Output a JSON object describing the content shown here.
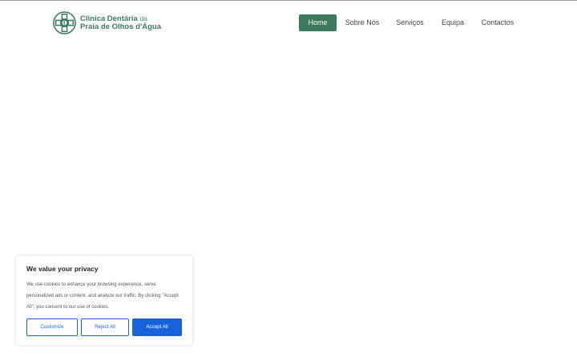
{
  "logo": {
    "line1": "Clinica Dentária",
    "line1_suffix": "da",
    "line2": "Praia de Olhos d'Água",
    "icon": "clinic-cross-logo-icon",
    "brand_color": "#3d7a5f"
  },
  "nav": {
    "items": [
      {
        "label": "Home",
        "active": true
      },
      {
        "label": "Sobre Nós",
        "active": false
      },
      {
        "label": "Serviços",
        "active": false
      },
      {
        "label": "Equipa",
        "active": false
      },
      {
        "label": "Contactos",
        "active": false
      }
    ],
    "active_color": "#3b7a5e"
  },
  "cookie_banner": {
    "title": "We value your privacy",
    "body": "We use cookies to enhance your browsing experience, serve personalized ads or content, and analyze our traffic. By clicking \"Accept All\", you consent to our use of cookies.",
    "buttons": {
      "customize": "Customize",
      "reject": "Reject All",
      "accept": "Accept All"
    },
    "accent_color": "#1863dc"
  }
}
